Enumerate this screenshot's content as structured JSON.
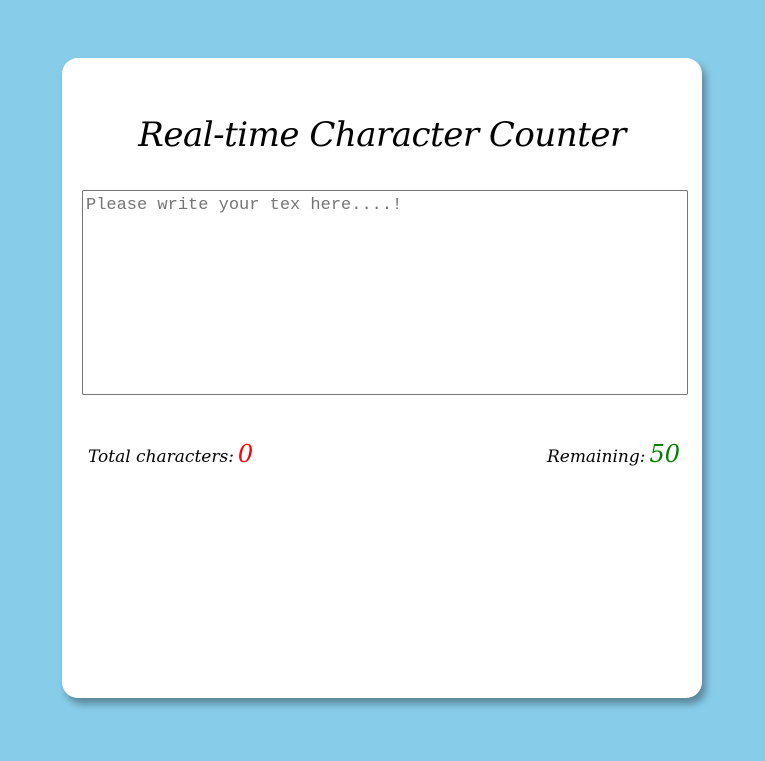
{
  "app": {
    "title": "Real-time Character Counter"
  },
  "input": {
    "placeholder": "Please write your tex here....!",
    "value": ""
  },
  "stats": {
    "total_label": "Total characters:",
    "total_value": "0",
    "remaining_label": "Remaining:",
    "remaining_value": "50"
  },
  "colors": {
    "background": "#87cdea",
    "card": "#ffffff",
    "total_value": "#ff0000",
    "remaining_value": "#008000"
  }
}
